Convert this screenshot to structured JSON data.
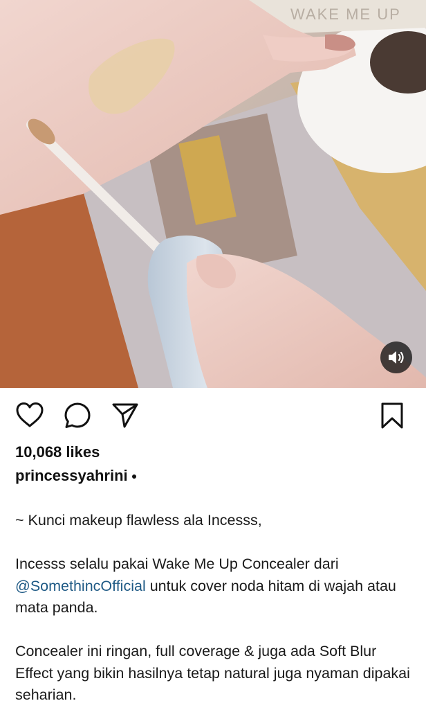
{
  "post": {
    "likes": "10,068 likes",
    "username": "princessyahrini",
    "mention": "@SomethincOfficial",
    "caption": {
      "line1": "~ Kunci makeup flawless ala Incesss,",
      "para2_before": "Incesss selalu pakai Wake Me Up Concealer dari ",
      "para2_after": " untuk cover noda hitam di wajah atau mata panda.",
      "para3": "Concealer ini ringan, full coverage & juga ada Soft Blur Effect yang bikin hasilnya tetap natural juga nyaman dipakai seharian."
    },
    "media_text": "WAKE ME UP"
  },
  "icons": {
    "like": "heart-icon",
    "comment": "speech-bubble-icon",
    "share": "paper-plane-icon",
    "save": "bookmark-icon",
    "sound": "speaker-on-icon"
  },
  "colors": {
    "mention": "#1f5a85",
    "text": "#111111",
    "background": "#ffffff"
  }
}
